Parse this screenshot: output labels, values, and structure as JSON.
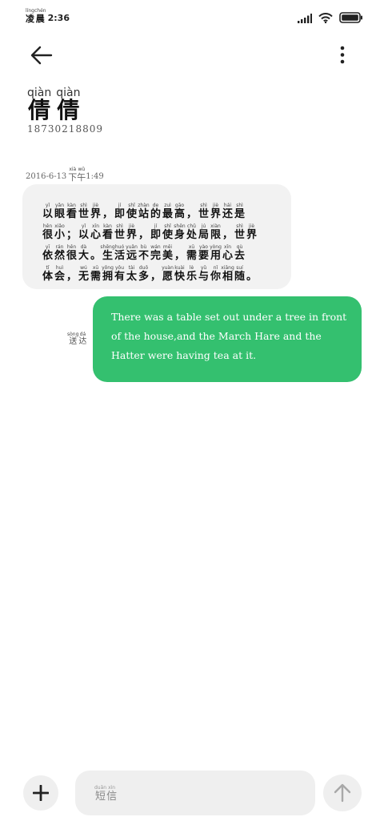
{
  "status_bar": {
    "time_chars": [
      {
        "hz": "凌",
        "py": "líng"
      },
      {
        "hz": "晨",
        "py": "chén"
      }
    ],
    "clock": "2:36",
    "icons": [
      "signal-icon",
      "wifi-icon",
      "battery-icon"
    ]
  },
  "header": {
    "back_icon": "arrow-left-icon",
    "more_icon": "more-vertical-icon"
  },
  "contact": {
    "name_chars": [
      {
        "hz": "倩",
        "py": "qiàn"
      },
      {
        "hz": "倩",
        "py": "qiàn"
      }
    ],
    "number": "18730218809"
  },
  "date": {
    "date_text": "2016-6-13",
    "period_chars": [
      {
        "hz": "下",
        "py": "xià"
      },
      {
        "hz": "午",
        "py": "wǔ"
      }
    ],
    "time_text": "1:49"
  },
  "incoming_message": {
    "lines": [
      [
        {
          "hz": "以",
          "py": "yǐ"
        },
        {
          "hz": "眼",
          "py": "yǎn"
        },
        {
          "hz": "看",
          "py": "kàn"
        },
        {
          "hz": "世",
          "py": "shì"
        },
        {
          "hz": "界",
          "py": "jiè"
        },
        {
          "hz": "，",
          "py": ""
        },
        {
          "hz": "即",
          "py": "jí"
        },
        {
          "hz": "使",
          "py": "shǐ"
        },
        {
          "hz": "站",
          "py": "zhàn"
        },
        {
          "hz": "的",
          "py": "de"
        },
        {
          "hz": "最",
          "py": "zuì"
        },
        {
          "hz": "高",
          "py": "gāo"
        },
        {
          "hz": "，",
          "py": ""
        },
        {
          "hz": "世",
          "py": "shì"
        },
        {
          "hz": "界",
          "py": "jiè"
        },
        {
          "hz": "还",
          "py": "hái"
        },
        {
          "hz": "是",
          "py": "shì"
        }
      ],
      [
        {
          "hz": "很",
          "py": "hěn"
        },
        {
          "hz": "小",
          "py": "xiǎo"
        },
        {
          "hz": "；",
          "py": ""
        },
        {
          "hz": "以",
          "py": "yǐ"
        },
        {
          "hz": "心",
          "py": "xīn"
        },
        {
          "hz": "看",
          "py": "kàn"
        },
        {
          "hz": "世",
          "py": "shì"
        },
        {
          "hz": "界",
          "py": "jiè"
        },
        {
          "hz": "，",
          "py": ""
        },
        {
          "hz": "即",
          "py": "jí"
        },
        {
          "hz": "使",
          "py": "shǐ"
        },
        {
          "hz": "身",
          "py": "shēn"
        },
        {
          "hz": "处",
          "py": "chǔ"
        },
        {
          "hz": "局",
          "py": "jú"
        },
        {
          "hz": "限",
          "py": "xiàn"
        },
        {
          "hz": "，",
          "py": ""
        },
        {
          "hz": "世",
          "py": "shì"
        },
        {
          "hz": "界",
          "py": "jiè"
        }
      ],
      [
        {
          "hz": "依",
          "py": "yī"
        },
        {
          "hz": "然",
          "py": "rán"
        },
        {
          "hz": "很",
          "py": "hěn"
        },
        {
          "hz": "大",
          "py": "dà"
        },
        {
          "hz": "。",
          "py": ""
        },
        {
          "hz": "生",
          "py": "shēng"
        },
        {
          "hz": "活",
          "py": "huó"
        },
        {
          "hz": "远",
          "py": "yuǎn"
        },
        {
          "hz": "不",
          "py": "bù"
        },
        {
          "hz": "完",
          "py": "wán"
        },
        {
          "hz": "美",
          "py": "měi"
        },
        {
          "hz": "，",
          "py": ""
        },
        {
          "hz": "需",
          "py": "xū"
        },
        {
          "hz": "要",
          "py": "yào"
        },
        {
          "hz": "用",
          "py": "yòng"
        },
        {
          "hz": "心",
          "py": "xīn"
        },
        {
          "hz": "去",
          "py": "qù"
        }
      ],
      [
        {
          "hz": "体",
          "py": "tǐ"
        },
        {
          "hz": "会",
          "py": "huì"
        },
        {
          "hz": "，",
          "py": ""
        },
        {
          "hz": "无",
          "py": "wú"
        },
        {
          "hz": "需",
          "py": "xū"
        },
        {
          "hz": "拥",
          "py": "yōng"
        },
        {
          "hz": "有",
          "py": "yǒu"
        },
        {
          "hz": "太",
          "py": "tài"
        },
        {
          "hz": "多",
          "py": "duō"
        },
        {
          "hz": "，",
          "py": ""
        },
        {
          "hz": "愿",
          "py": "yuàn"
        },
        {
          "hz": "快",
          "py": "kuài"
        },
        {
          "hz": "乐",
          "py": "lè"
        },
        {
          "hz": "与",
          "py": "yǔ"
        },
        {
          "hz": "你",
          "py": "nǐ"
        },
        {
          "hz": "相",
          "py": "xiāng"
        },
        {
          "hz": "随",
          "py": "suí"
        },
        {
          "hz": "。",
          "py": ""
        }
      ]
    ]
  },
  "outgoing_message": {
    "text": "There was a table set out under a tree in front of the house,and the March Hare and the Hatter were having tea at it.",
    "delivered_chars": [
      {
        "hz": "送",
        "py": "sòng"
      },
      {
        "hz": "达",
        "py": "dá"
      }
    ]
  },
  "composer": {
    "add_icon": "plus-icon",
    "placeholder_chars": [
      {
        "hz": "短",
        "py": "duǎn"
      },
      {
        "hz": "信",
        "py": "xìn"
      }
    ],
    "send_icon": "arrow-up-icon"
  },
  "colors": {
    "outgoing_bubble": "#34c06f",
    "incoming_bubble": "#f2f2f2",
    "button_bg": "#efefef"
  }
}
